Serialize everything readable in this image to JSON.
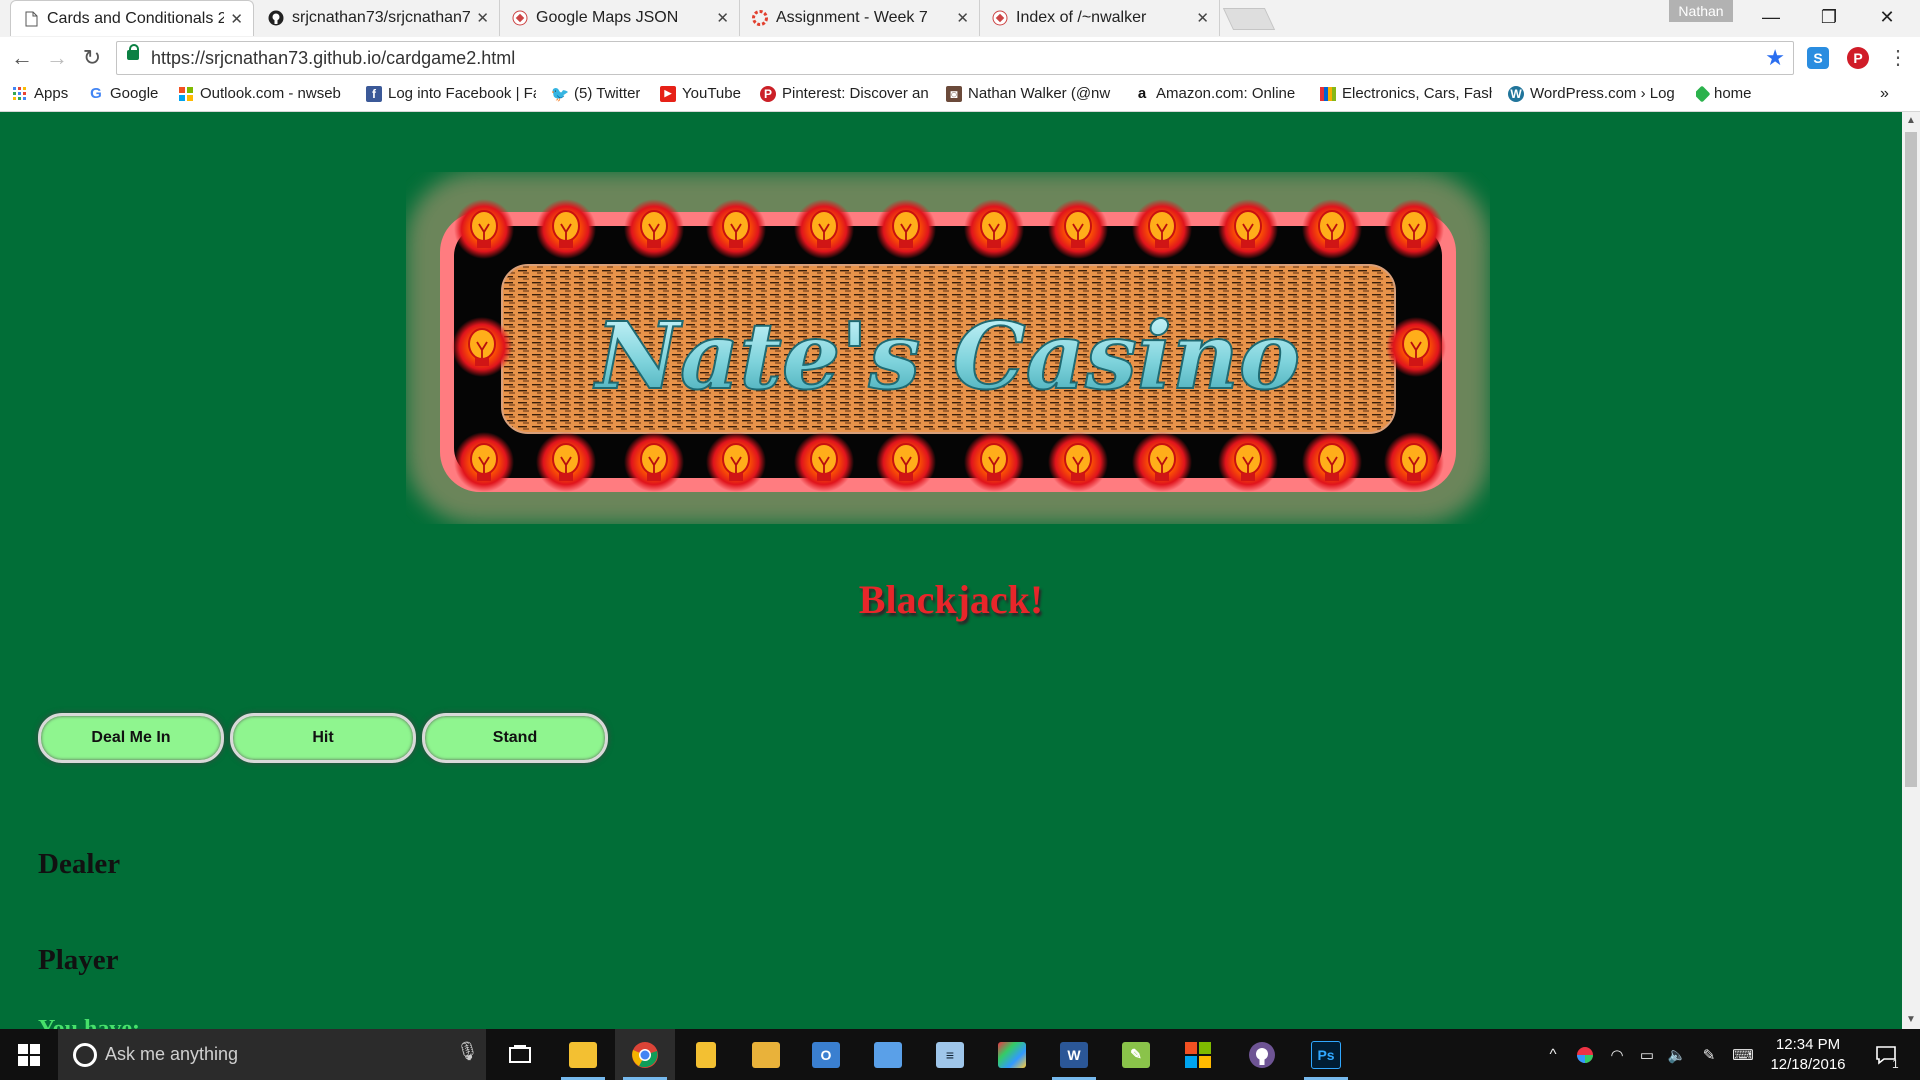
{
  "browser": {
    "tabs": [
      {
        "title": "Cards and Conditionals 2",
        "active": true,
        "icon": "document-icon"
      },
      {
        "title": "srjcnathan73/srjcnathan7",
        "active": false,
        "icon": "github-icon"
      },
      {
        "title": "Google Maps JSON",
        "active": false,
        "icon": "page-icon"
      },
      {
        "title": "Assignment - Week 7",
        "active": false,
        "icon": "canvas-icon"
      },
      {
        "title": "Index of /~nwalker",
        "active": false,
        "icon": "page-icon"
      }
    ],
    "profile_name": "Nathan",
    "window_controls": {
      "minimize": "—",
      "restore": "❐",
      "close": "✕"
    },
    "url": "https://srjcnathan73.github.io/cardgame2.html",
    "nav": {
      "back": "←",
      "forward": "→",
      "reload": "↻",
      "star": "★",
      "menu": "⋮"
    },
    "bookmarks": [
      {
        "label": "Apps",
        "icon": "apps-grid-icon"
      },
      {
        "label": "Google",
        "icon": "google-icon"
      },
      {
        "label": "Outlook.com - nwseb",
        "icon": "windows-logo-icon"
      },
      {
        "label": "Log into Facebook | Fa",
        "icon": "facebook-icon"
      },
      {
        "label": "(5) Twitter",
        "icon": "twitter-icon"
      },
      {
        "label": "YouTube",
        "icon": "youtube-icon"
      },
      {
        "label": "Pinterest: Discover an",
        "icon": "pinterest-icon"
      },
      {
        "label": "Nathan Walker (@nw",
        "icon": "instagram-icon"
      },
      {
        "label": "Amazon.com: Online",
        "icon": "amazon-icon"
      },
      {
        "label": "Electronics, Cars, Fash",
        "icon": "ebay-icon"
      },
      {
        "label": "WordPress.com › Log",
        "icon": "wordpress-icon"
      },
      {
        "label": "home",
        "icon": "feedly-icon"
      }
    ],
    "bookmarks_overflow": "»"
  },
  "page": {
    "logo_text": "Nate's Casino",
    "title": "Blackjack!",
    "buttons": {
      "deal": "Deal Me In",
      "hit": "Hit",
      "stand": "Stand"
    },
    "dealer_heading": "Dealer",
    "player_heading": "Player",
    "player_status": "You have:"
  },
  "taskbar": {
    "search_placeholder": "Ask me anything",
    "time": "12:34 PM",
    "date": "12/18/2016",
    "notification_count": "1",
    "apps": [
      "task-view-icon",
      "file-explorer-icon",
      "chrome-icon",
      "files-icon",
      "folder-icon",
      "outlook-icon",
      "laptop-icon",
      "notepad-icon",
      "paint-icon",
      "word-icon",
      "notepad-plus-icon",
      "windows-store-icon",
      "github-desktop-icon",
      "photoshop-icon"
    ]
  }
}
